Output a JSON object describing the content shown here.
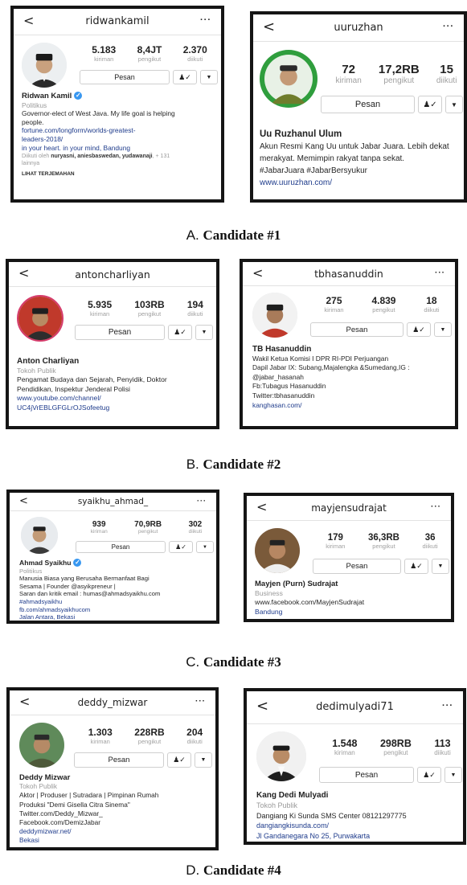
{
  "captions": [
    {
      "letter": "A.",
      "text": "Candidate #1"
    },
    {
      "letter": "B.",
      "text": "Candidate #2"
    },
    {
      "letter": "C.",
      "text": "Candidate #3"
    },
    {
      "letter": "D.",
      "text": "Candidate #4"
    }
  ],
  "labels": {
    "posts": "kiriman",
    "followers": "pengikut",
    "following": "diikuti",
    "message": "Pesan",
    "back": "<",
    "more": "···",
    "follow_icon": "person-check-icon",
    "dropdown_icon": "caret-down-icon"
  },
  "profiles": {
    "ridwankamil": {
      "username": "ridwankamil",
      "posts": "5.183",
      "followers": "8,4JT",
      "following": "2.370",
      "name": "Ridwan Kamil",
      "verified": true,
      "category": "Politikus",
      "bio": [
        "Governor-elect of West Java. My life goal is helping",
        "people."
      ],
      "links": [
        "fortune.com/longform/worlds-greatest-",
        "leaders-2018/"
      ],
      "extra": "in your heart. in your mind, Bandung",
      "followed_by_prefix": "Diikuti oleh ",
      "followed_by_names": "nuryasni, aniesbaswedan, yudawanaji",
      "followed_by_suffix": ", + 131",
      "followed_by_more": "lainnya",
      "translate": "LIHAT TERJEMAHAN"
    },
    "uuruzhan": {
      "username": "uuruzhan",
      "posts": "72",
      "followers": "17,2RB",
      "following": "15",
      "name": "Uu Ruzhanul Ulum",
      "bio": [
        "Akun Resmi Kang Uu untuk Jabar Juara. Lebih dekat",
        "merakyat. Memimpin rakyat tanpa sekat.",
        "#JabarJuara #JabarBersyukur"
      ],
      "link": "www.uuruzhan.com/"
    },
    "antoncharliyan": {
      "username": "antoncharliyan",
      "posts": "5.935",
      "followers": "103RB",
      "following": "194",
      "name": "Anton Charliyan",
      "category": "Tokoh Publik",
      "bio": [
        "Pengamat Budaya dan Sejarah, Penyidik, Doktor",
        "Pendidikan, Inspektur Jenderal Polisi"
      ],
      "links": [
        "www.youtube.com/channel/",
        "UC4jVrEBLGFGLrOJSofeetug"
      ]
    },
    "tbhasanuddin": {
      "username": "tbhasanuddin",
      "posts": "275",
      "followers": "4.839",
      "following": "18",
      "name": "TB Hasanuddin",
      "bio": [
        "Wakil Ketua Komisi I DPR RI-PDI Perjuangan",
        "Dapil Jabar IX: Subang,Majalengka &Sumedang,IG :",
        "@jabar_hasanah",
        "Fb:Tubagus Hasanuddin",
        "Twitter:tbhasanuddin"
      ],
      "link": "kanghasan.com/"
    },
    "syaikhu": {
      "username": "syaikhu_ahmad_",
      "posts": "939",
      "followers": "70,9RB",
      "following": "302",
      "name": "Ahmad Syaikhu",
      "verified": true,
      "category": "Politikus",
      "bio": [
        "Manusia Biasa yang Berusaha Bermanfaat Bagi",
        "Sesama | Founder @asyikpreneur |",
        "Saran dan kritik email : humas@ahmadsyaikhu.com",
        "#ahmadsyaikhu"
      ],
      "links": [
        "fb.com/ahmadsyaikhucom",
        "Jalan Antara, Bekasi"
      ]
    },
    "sudrajat": {
      "username": "mayjensudrajat",
      "posts": "179",
      "followers": "36,3RB",
      "following": "36",
      "name": "Mayjen (Purn) Sudrajat",
      "category": "Business",
      "bio": [
        "www.facebook.com/MayjenSudrajat"
      ],
      "link": "Bandung"
    },
    "deddy": {
      "username": "deddy_mizwar",
      "posts": "1.303",
      "followers": "228RB",
      "following": "204",
      "name": "Deddy Mizwar",
      "category": "Tokoh Publik",
      "bio": [
        "Aktor | Produser | Sutradara | Pimpinan Rumah",
        "Produksi \"Demi Gisella Citra Sinema\"",
        "Twitter.com/Deddy_Mizwar_",
        "Facebook.com/DemizJabar"
      ],
      "links": [
        "deddymizwar.net/",
        "Bekasi"
      ]
    },
    "dedi": {
      "username": "dedimulyadi71",
      "posts": "1.548",
      "followers": "298RB",
      "following": "113",
      "name": "Kang Dedi Mulyadi",
      "category": "Tokoh Publik",
      "bio": [
        "Dangiang Ki Sunda SMS Center 08121297775"
      ],
      "links": [
        "dangiangkisunda.com/",
        "Jl Gandanegara No 25, Purwakarta"
      ]
    }
  }
}
